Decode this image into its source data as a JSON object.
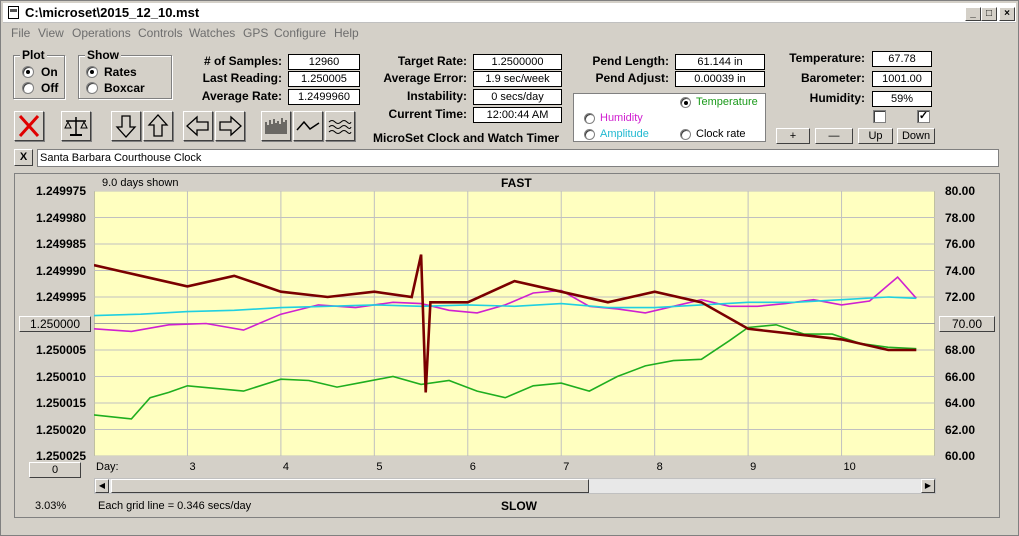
{
  "window": {
    "title": "C:\\microset\\2015_12_10.mst",
    "min": "_",
    "max": "□",
    "close": "×"
  },
  "menu": [
    "File",
    "View",
    "Operations",
    "Controls",
    "Watches",
    "GPS",
    "Configure",
    "Help"
  ],
  "plot_group": {
    "caption": "Plot",
    "options": [
      "On",
      "Off"
    ],
    "selected": "On"
  },
  "show_group": {
    "caption": "Show",
    "options": [
      "Rates",
      "Boxcar"
    ],
    "selected": "Rates"
  },
  "stats": {
    "samples_label": "# of Samples:",
    "samples": "12960",
    "last_label": "Last Reading:",
    "last": "1.250005",
    "avg_rate_label": "Average Rate:",
    "avg_rate": "1.2499960",
    "target_label": "Target Rate:",
    "target": "1.2500000",
    "avg_err_label": "Average Error:",
    "avg_err": "1.9 sec/week",
    "instab_label": "Instability:",
    "instab": "0 secs/day",
    "time_label": "Current Time:",
    "time": "12:00:44 AM",
    "pend_len_label": "Pend Length:",
    "pend_len": "61.144 in",
    "pend_adj_label": "Pend Adjust:",
    "pend_adj": "0.00039 in",
    "temp_label": "Temperature:",
    "temp": "67.78",
    "baro_label": "Barometer:",
    "baro": "1001.00",
    "hum_label": "Humidity:",
    "hum": "59%",
    "app_caption": "MicroSet Clock and Watch Timer"
  },
  "sensor_select": {
    "options": [
      "Temperature",
      "Humidity",
      "Amplitude",
      "Clock rate"
    ],
    "selected": "Temperature",
    "colors": {
      "Temperature": "#1a9a1a",
      "Humidity": "#d020d0",
      "Amplitude": "#20c8e0",
      "Clock rate": "#000000"
    }
  },
  "scale_buttons": {
    "plus": "+",
    "minus": "—",
    "up": "Up",
    "down": "Down"
  },
  "checkboxes": [
    {
      "checked": false
    },
    {
      "checked": true
    }
  ],
  "clock_name": "Santa Barbara Courthouse Clock",
  "clear_button": "X",
  "graph": {
    "days_shown": "9.0 days shown",
    "fast": "FAST",
    "slow": "SLOW",
    "left_center_button": "1.250000",
    "right_center_button": "70.00",
    "bottom_left_button": "0",
    "day_label": "Day:",
    "percent": "3.03%",
    "grid_note": "Each grid line = 0.346 secs/day"
  },
  "chart_data": {
    "type": "line",
    "title": "",
    "x_label": "Day:",
    "x_ticks": [
      "3",
      "4",
      "5",
      "6",
      "7",
      "8",
      "9",
      "10"
    ],
    "xlim": [
      2.0,
      11.0
    ],
    "y_left_ticks": [
      "1.249975",
      "1.249980",
      "1.249985",
      "1.249990",
      "1.249995",
      "1.250000",
      "1.250005",
      "1.250010",
      "1.250015",
      "1.250020",
      "1.250025"
    ],
    "y_left_range": [
      1.249975,
      1.250025
    ],
    "y_left_inverted": true,
    "y_right_ticks": [
      "80.00",
      "78.00",
      "76.00",
      "74.00",
      "72.00",
      "70.00",
      "68.00",
      "66.00",
      "64.00",
      "62.00",
      "60.00"
    ],
    "y_right_range": [
      60,
      80
    ],
    "grid": true,
    "background": "#ffffc0",
    "series": [
      {
        "name": "Temperature",
        "color": "#1fae1f",
        "axis": "right",
        "x": [
          2.0,
          2.4,
          2.6,
          2.8,
          3.0,
          3.3,
          3.6,
          4.0,
          4.3,
          4.6,
          4.9,
          5.2,
          5.5,
          5.8,
          6.1,
          6.4,
          6.7,
          7.0,
          7.3,
          7.6,
          7.9,
          8.2,
          8.5,
          8.8,
          9.0,
          9.3,
          9.6,
          9.9,
          10.2,
          10.5,
          10.8
        ],
        "y": [
          63.1,
          62.8,
          64.4,
          64.8,
          65.3,
          65.1,
          64.9,
          65.8,
          65.7,
          65.2,
          65.6,
          66.0,
          65.4,
          65.7,
          64.9,
          64.4,
          65.3,
          65.5,
          64.9,
          66.0,
          66.8,
          67.2,
          67.3,
          68.7,
          69.7,
          69.9,
          69.2,
          69.2,
          68.5,
          68.2,
          68.1
        ]
      },
      {
        "name": "Humidity",
        "color": "#d020d0",
        "axis": "right",
        "x": [
          2.0,
          2.4,
          2.8,
          3.2,
          3.6,
          4.0,
          4.4,
          4.8,
          5.2,
          5.5,
          5.8,
          6.1,
          6.4,
          6.7,
          7.0,
          7.3,
          7.6,
          7.9,
          8.2,
          8.5,
          8.8,
          9.1,
          9.4,
          9.7,
          10.0,
          10.3,
          10.6,
          10.8
        ],
        "y": [
          69.6,
          69.4,
          69.9,
          70.0,
          69.5,
          70.7,
          71.4,
          71.2,
          71.6,
          71.5,
          71.0,
          70.8,
          71.4,
          72.3,
          72.5,
          71.3,
          71.1,
          70.8,
          71.3,
          71.8,
          71.3,
          71.3,
          71.5,
          71.8,
          71.4,
          71.7,
          73.5,
          71.9
        ]
      },
      {
        "name": "Amplitude",
        "color": "#20d0e0",
        "axis": "right",
        "x": [
          2.0,
          2.5,
          3.0,
          3.5,
          4.0,
          4.5,
          5.0,
          5.5,
          6.0,
          6.5,
          7.0,
          7.5,
          8.0,
          8.5,
          9.0,
          9.5,
          10.0,
          10.5,
          10.8
        ],
        "y": [
          70.6,
          70.7,
          70.9,
          71.0,
          71.2,
          71.3,
          71.4,
          71.3,
          71.4,
          71.3,
          71.5,
          71.2,
          71.2,
          71.4,
          71.6,
          71.6,
          71.8,
          72.0,
          71.9
        ]
      },
      {
        "name": "Clock rate",
        "color": "#7a0000",
        "axis": "left",
        "x": [
          2.0,
          2.5,
          3.0,
          3.5,
          4.0,
          4.5,
          5.0,
          5.4,
          5.5,
          5.55,
          5.6,
          6.0,
          6.5,
          7.0,
          7.5,
          8.0,
          8.5,
          9.0,
          9.5,
          10.0,
          10.5,
          10.8
        ],
        "y": [
          1.249989,
          1.249991,
          1.249993,
          1.249991,
          1.249994,
          1.249995,
          1.249994,
          1.249995,
          1.249987,
          1.250013,
          1.249996,
          1.249996,
          1.249992,
          1.249994,
          1.249996,
          1.249994,
          1.249996,
          1.250001,
          1.250002,
          1.250003,
          1.250005,
          1.250005
        ]
      }
    ]
  }
}
